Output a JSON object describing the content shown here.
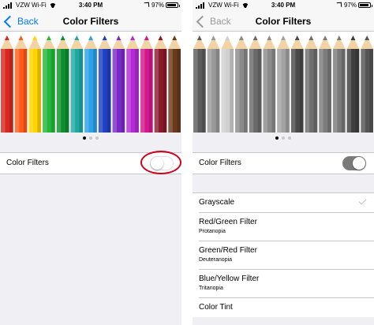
{
  "status_bar": {
    "carrier": "VZW Wi-Fi",
    "time": "3:40 PM",
    "battery": "97%"
  },
  "nav": {
    "back_label": "Back",
    "title": "Color Filters"
  },
  "pencils": {
    "colors": [
      "#d8281f",
      "#ff5a1a",
      "#ffd400",
      "#24b83a",
      "#0e8f2e",
      "#1fa9a1",
      "#2aa0e8",
      "#1f3fc4",
      "#7a2ac8",
      "#b22bd6",
      "#d4178c",
      "#8a1a2a",
      "#6a3a1c"
    ],
    "grays": [
      "#5c5c5c",
      "#9a9a9a",
      "#d0d0d0",
      "#8a8a8a",
      "#6a6a6a",
      "#8c8c8c",
      "#a2a2a2",
      "#4a4a4a",
      "#6e6e6e",
      "#7c7c7c",
      "#7a7a7a",
      "#3e3e3e",
      "#555555"
    ]
  },
  "toggle_label": "Color Filters",
  "toggle_left_state": "off",
  "toggle_right_state": "on",
  "filters": [
    {
      "name": "Grayscale",
      "subtitle": "",
      "selected": true
    },
    {
      "name": "Red/Green Filter",
      "subtitle": "Protanopia",
      "selected": false
    },
    {
      "name": "Green/Red Filter",
      "subtitle": "Deuteranopia",
      "selected": false
    },
    {
      "name": "Blue/Yellow Filter",
      "subtitle": "Tritanopia",
      "selected": false
    },
    {
      "name": "Color Tint",
      "subtitle": "",
      "selected": false
    }
  ],
  "colors": {
    "accent": "#007aff",
    "highlight_ring": "#d0021b",
    "background": "#efeff4"
  },
  "icons": [
    "signal-icon",
    "wifi-icon",
    "location-icon",
    "battery-icon",
    "back-chevron-icon",
    "checkmark-icon"
  ]
}
